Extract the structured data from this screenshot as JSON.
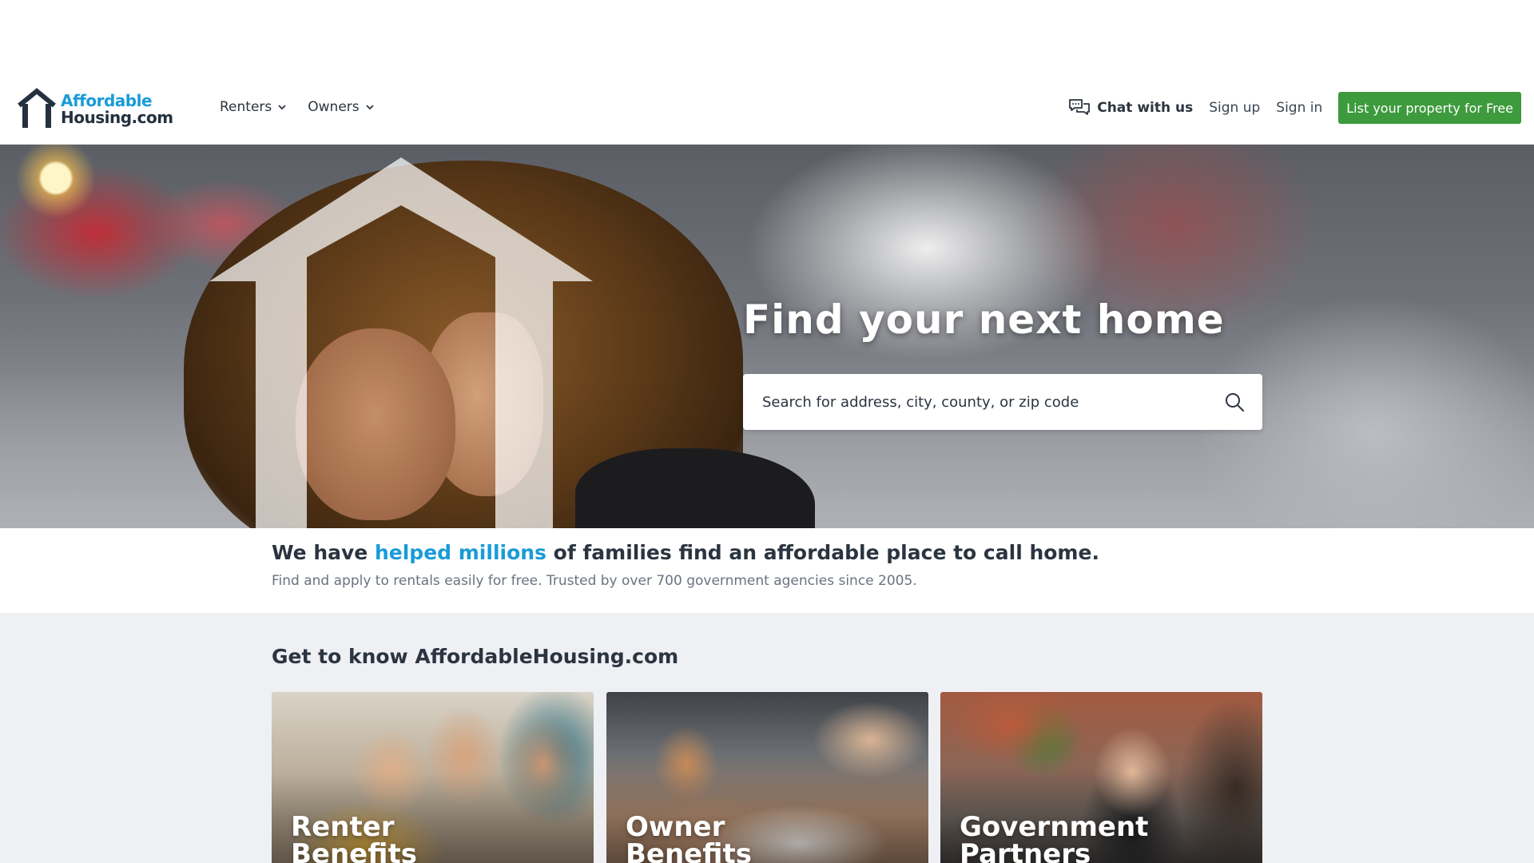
{
  "header": {
    "logo": {
      "line1": "Affordable",
      "line2": "Housing.com"
    },
    "nav": [
      {
        "label": "Renters"
      },
      {
        "label": "Owners"
      }
    ],
    "chat_label": "Chat with us",
    "signup_label": "Sign up",
    "signin_label": "Sign in",
    "cta_label": "List your property for Free"
  },
  "hero": {
    "title": "Find your next home",
    "search_placeholder": "Search for address, city, county, or zip code"
  },
  "stats": {
    "lead": "We have",
    "highlight": "helped millions",
    "rest": "of families find an affordable place to call home.",
    "subtitle": "Find and apply to rentals easily for free. Trusted by over 700 government agencies since 2005."
  },
  "know": {
    "title": "Get to know AffordableHousing.com",
    "cards": [
      {
        "line1": "Renter",
        "line2": "Benefits"
      },
      {
        "line1": "Owner",
        "line2": "Benefits"
      },
      {
        "line1": "Government",
        "line2": "Partners"
      }
    ]
  },
  "colors": {
    "brand_blue": "#1a9bd7",
    "brand_dark": "#25313f",
    "cta_green": "#3d9a3d",
    "section_bg": "#eef0f3"
  },
  "icons": {
    "logo": "house-outline-icon",
    "nav_chevron": "chevron-down-icon",
    "chat": "chat-bubbles-icon",
    "search": "search-icon"
  }
}
